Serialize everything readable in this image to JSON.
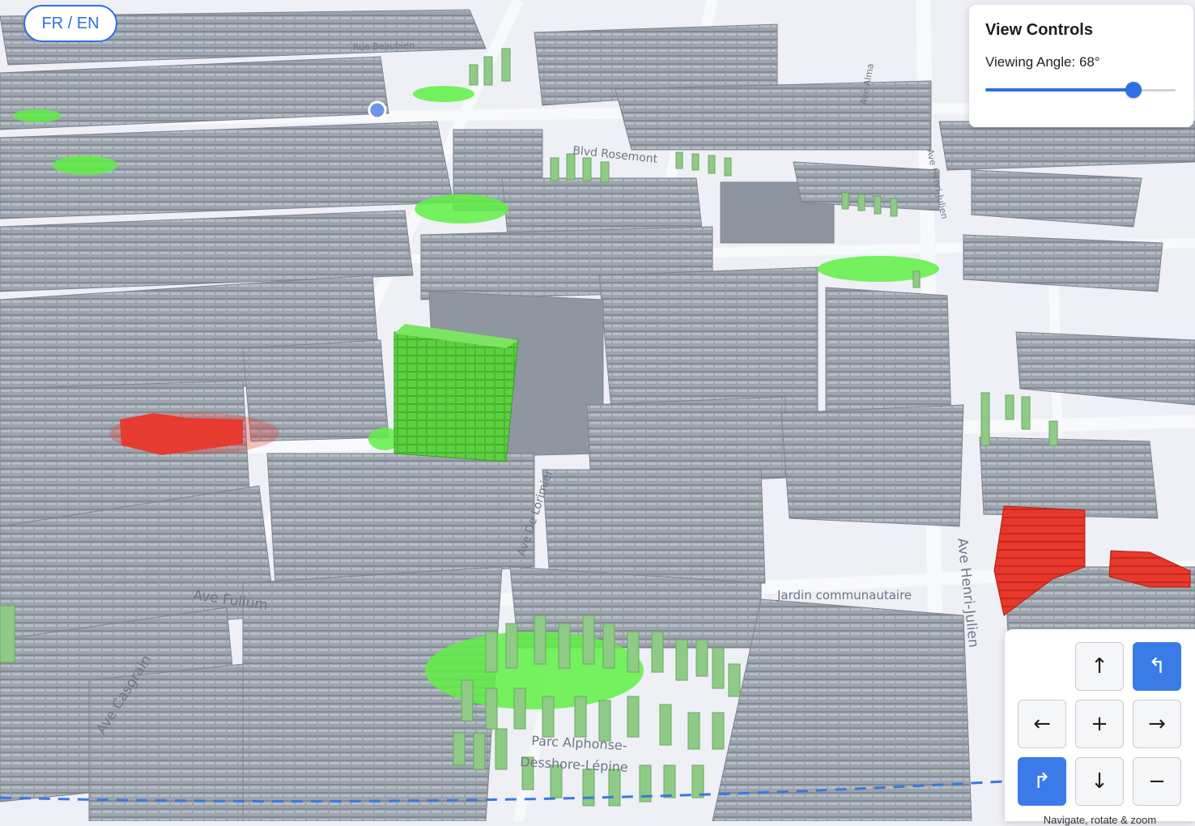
{
  "language_toggle": {
    "label": "FR / EN"
  },
  "view_controls": {
    "title": "View Controls",
    "angle_label": "Viewing Angle:",
    "angle_value": 68,
    "angle_unit": "°",
    "slider_fraction": 0.78
  },
  "navigation": {
    "rotate_left_symbol": "↰",
    "rotate_right_symbol": "↱",
    "up_symbol": "↑",
    "down_symbol": "↓",
    "left_symbol": "←",
    "right_symbol": "→",
    "zoom_in_symbol": "+",
    "zoom_out_symbol": "−",
    "caption": "Navigate, rotate & zoom"
  },
  "map": {
    "street_labels": [
      "Rue Beaubien",
      "Blvd Rosemont",
      "Ave Henri-Julien",
      "Ave Henri-Julien",
      "Ave Casgrain",
      "Ave Fullum",
      "Ave De Lorimier",
      "Ave Alma",
      "Jardin communautaire",
      "Parc Alphonse-",
      "Desshore-Lépine"
    ],
    "colors": {
      "building": "#9aa1ab",
      "park": "#5ff044",
      "tree": "#8fca86",
      "highlight": "#e8372c",
      "road": "#f3f4f8",
      "boundary": "#3a78e0"
    }
  }
}
